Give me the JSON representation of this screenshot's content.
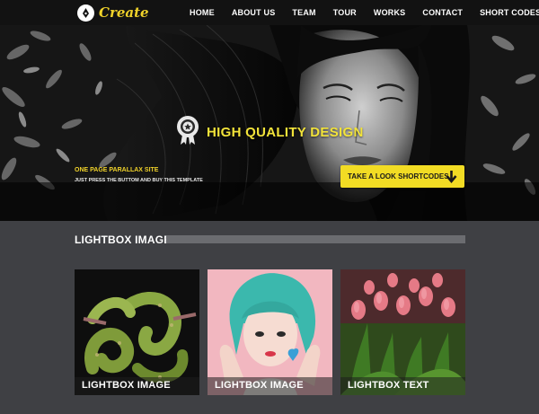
{
  "nav": {
    "logo_text": "Create",
    "items": [
      {
        "label": "HOME"
      },
      {
        "label": "ABOUT US"
      },
      {
        "label": "TEAM"
      },
      {
        "label": "TOUR"
      },
      {
        "label": "WORKS"
      },
      {
        "label": "CONTACT"
      },
      {
        "label": "SHORT CODES"
      }
    ]
  },
  "hero": {
    "title": "HIGH QUALITY DESIGN",
    "band_heading": "ONE PAGE PARALLAX SITE",
    "band_sub": "JUST PRESS THE BUTTOM AND BUY THIS TEMPLATE",
    "cta_label": "TAKE A LOOK SHORTCODES"
  },
  "section": {
    "title": "LIGHTBOX IMAGES",
    "tiles": [
      {
        "caption": "LIGHTBOX IMAGE",
        "icon": "snake-photo"
      },
      {
        "caption": "LIGHTBOX IMAGE",
        "icon": "portrait-photo"
      },
      {
        "caption": "LIGHTBOX TEXT",
        "icon": "tulips-photo"
      }
    ]
  },
  "colors": {
    "accent": "#f2dc24",
    "nav_bg": "#121212",
    "page_bg": "#3f4044"
  }
}
